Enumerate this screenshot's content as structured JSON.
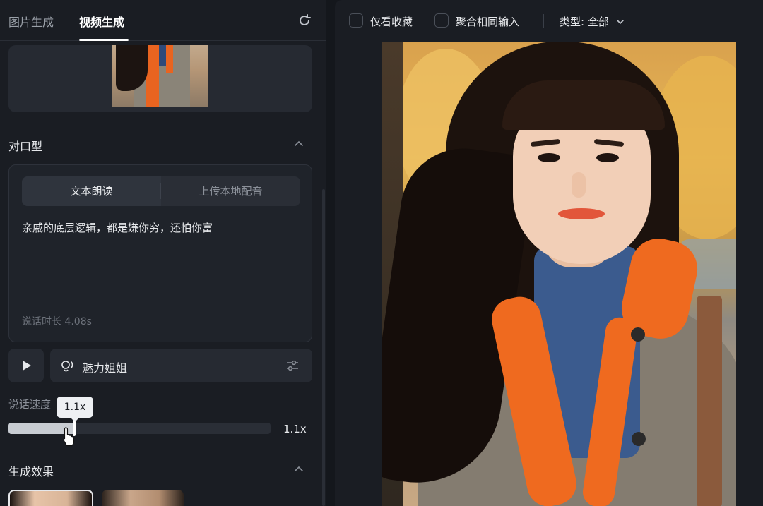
{
  "tabs": [
    {
      "label": "图片生成"
    },
    {
      "label": "视频生成"
    }
  ],
  "lip_sync": {
    "title": "对口型",
    "modes": [
      "文本朗读",
      "上传本地配音"
    ],
    "text": "亲戚的底层逻辑，都是嫌你穷，还怕你富",
    "duration": "说话时长 4.08s"
  },
  "voice": {
    "name": "魅力姐姐"
  },
  "speed": {
    "label": "说话速度",
    "tooltip": "1.1x",
    "value_text": "1.1x",
    "fraction": 0.25
  },
  "effects": {
    "title": "生成效果"
  },
  "filters": {
    "favorites": "仅看收藏",
    "merge_same": "聚合相同输入",
    "type": "类型: 全部"
  },
  "colors": {
    "panel_bg": "#1a1d23",
    "card_bg": "#262a32",
    "accent_orange": "#ef6a1f"
  }
}
